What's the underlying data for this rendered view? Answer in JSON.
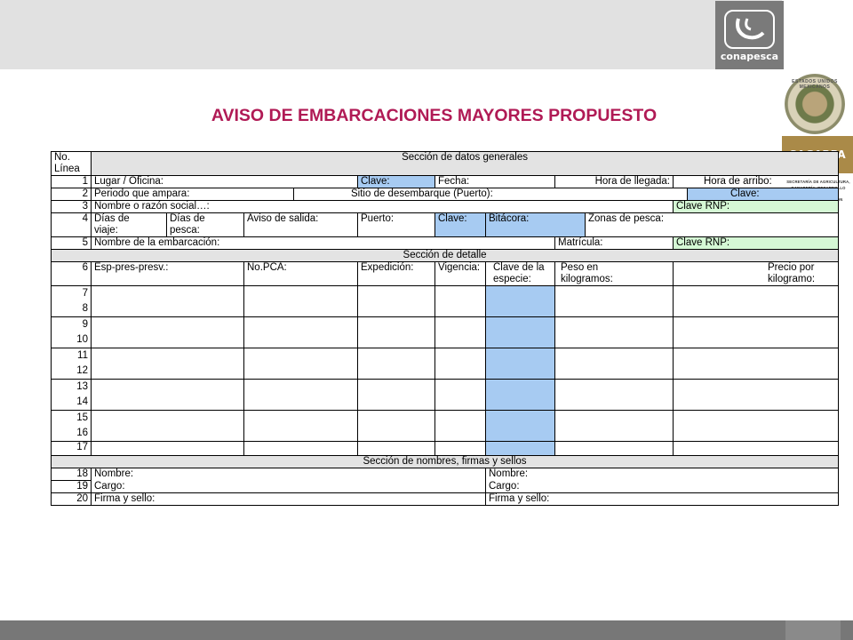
{
  "header": {
    "logo_text": "conapesca",
    "title": "AVISO DE EMBARCACIONES MAYORES PROPUESTO",
    "seal_text": "ESTADOS UNIDOS MEXICANOS",
    "sagarpa": "SAGARPA",
    "secretaria_lines": [
      "SECRETARÍA DE AGRICULTURA,",
      "GANADERÍA, DESARROLLO RURAL,",
      "PESCA Y ALIMENTACIÓN"
    ]
  },
  "table": {
    "no_linea": [
      "No.",
      "Línea"
    ],
    "sec_generales": "Sección de datos generales",
    "r1": {
      "num": "1",
      "lugar": "Lugar / Oficina:",
      "clave": "Clave:",
      "fecha": "Fecha:",
      "hora_llegada": "Hora de llegada:",
      "hora_arribo": "Hora de arribo:"
    },
    "r2": {
      "num": "2",
      "periodo": "Periodo que ampara:",
      "sitio": "Sitio de desembarque (Puerto):",
      "clave": "Clave:"
    },
    "r3": {
      "num": "3",
      "nombre": "Nombre o razón social…:",
      "clave_rnp": "Clave RNP:"
    },
    "r4": {
      "num": "4",
      "dias_viaje": [
        "Días de",
        "viaje:"
      ],
      "dias_pesca": [
        "Días de",
        "pesca:"
      ],
      "aviso": "Aviso de salida:",
      "puerto": "Puerto:",
      "clave": "Clave:",
      "bitacora": "Bitácora:",
      "zonas": "Zonas de pesca:"
    },
    "r5": {
      "num": "5",
      "nombre_emb": "Nombre de la embarcación:",
      "matricula": "Matrícula:",
      "clave_rnp": "Clave RNP:"
    },
    "sec_detalle": "Sección de detalle",
    "r6": {
      "num": "6",
      "esp": "Esp-pres-presv.:",
      "pca": "No.PCA:",
      "expedicion": "Expedición:",
      "vigencia": "Vigencia:",
      "clave_especie": [
        "Clave de la",
        "especie:"
      ],
      "peso": [
        "Peso en",
        "kilogramos:"
      ],
      "precio": [
        "Precio por",
        "kilogramo:"
      ]
    },
    "detail_pairs": [
      [
        "7",
        "8"
      ],
      [
        "9",
        "10"
      ],
      [
        "11",
        "12"
      ],
      [
        "13",
        "14"
      ],
      [
        "15",
        "16"
      ]
    ],
    "r17": "17",
    "sec_nombres": "Sección de nombres, firmas y sellos",
    "r18": {
      "num": "18",
      "left": "Nombre:",
      "right": "Nombre:"
    },
    "r19": {
      "num": "19",
      "left": "Cargo:",
      "right": "Cargo:"
    },
    "r20": {
      "num": "20",
      "left": "Firma y sello:",
      "right": "Firma y sello:"
    }
  },
  "colors": {
    "title": "#b01a55",
    "blue_cell": "#a7cbf2",
    "green_cell": "#d5f8d5",
    "band_gray": "#e3e3e3",
    "sagarpa_gold": "#aa8a48"
  }
}
